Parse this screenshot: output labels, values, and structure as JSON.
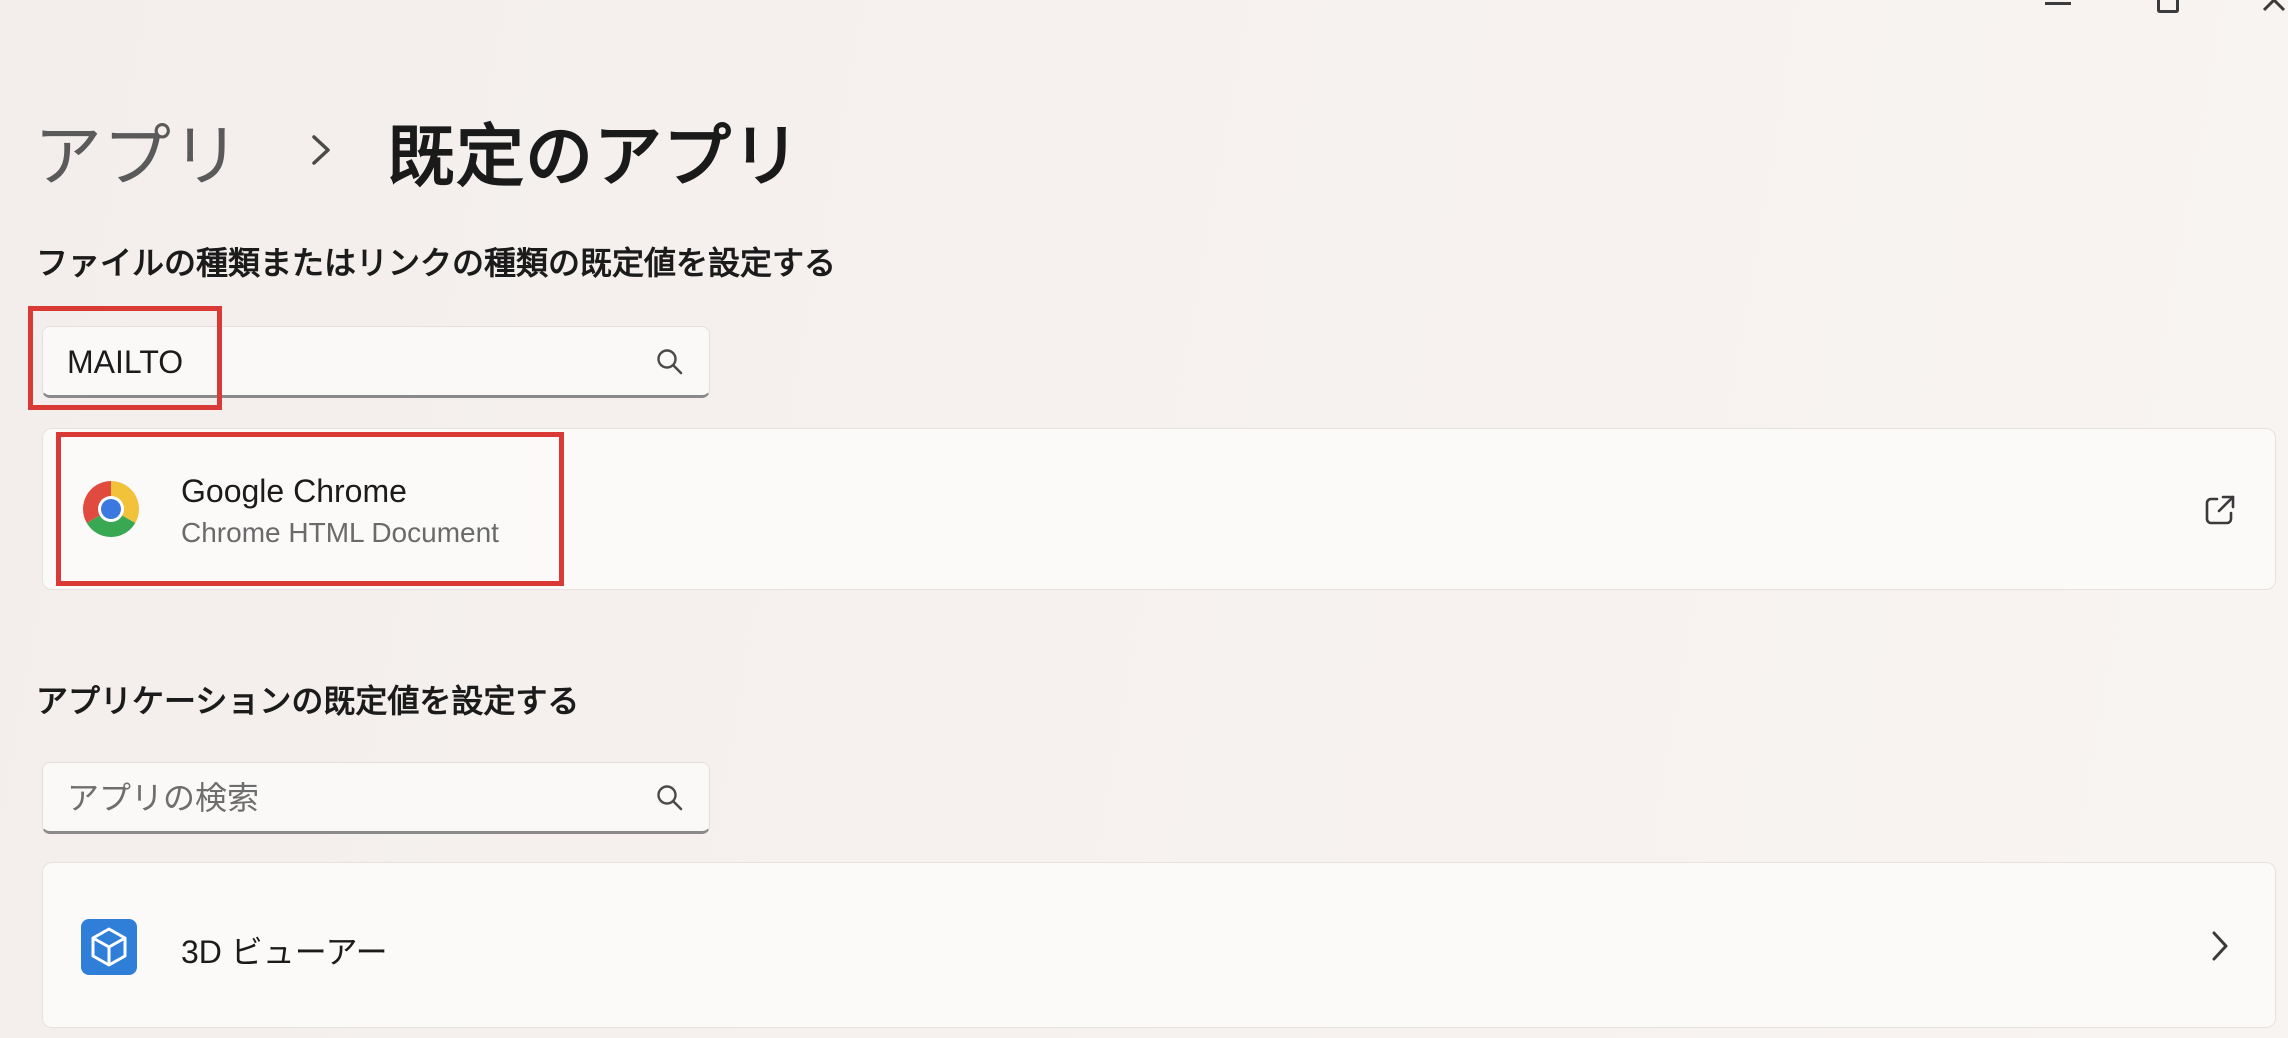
{
  "window": {
    "controls": [
      {
        "name": "minimize",
        "icon": "minimize-icon"
      },
      {
        "name": "maximize",
        "icon": "restore-icon"
      },
      {
        "name": "close",
        "icon": "close-icon"
      }
    ]
  },
  "breadcrumb": {
    "parent": "アプリ",
    "separator_icon": "chevron-right-icon",
    "current": "既定のアプリ"
  },
  "file_type_section": {
    "title": "ファイルの種類またはリンクの種類の既定値を設定する",
    "search": {
      "value": "MAILTO",
      "placeholder": "",
      "icon": "search-icon"
    },
    "result": {
      "app_name": "Google Chrome",
      "description": "Chrome HTML Document",
      "app_icon": "chrome-icon",
      "action_icon": "open-external-icon"
    }
  },
  "app_section": {
    "title": "アプリケーションの既定値を設定する",
    "search": {
      "value": "",
      "placeholder": "アプリの検索",
      "icon": "search-icon"
    },
    "items": [
      {
        "label": "3D ビューアー",
        "icon": "3d-viewer-icon",
        "chevron": "chevron-right-icon"
      }
    ]
  },
  "highlights": {
    "color": "#d93a36"
  },
  "colors": {
    "accent_blue": "#2f7fd8",
    "background": "#f5f0ee"
  }
}
